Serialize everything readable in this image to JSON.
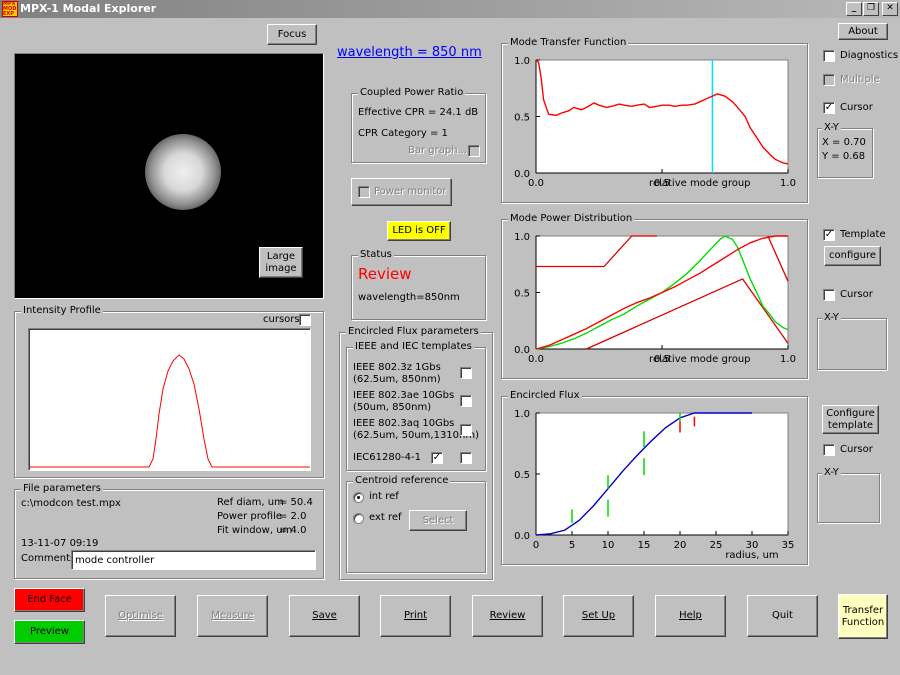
{
  "window": {
    "title": "MPX-1 Modal Explorer",
    "icon_text": "MPX MOD EXP",
    "min": "_",
    "restore": "❐",
    "close": "✕"
  },
  "top": {
    "focus_label": "Focus",
    "wavelength_text": "wavelength = 850 nm",
    "about_label": "About"
  },
  "image": {
    "large_label": "Large\nimage"
  },
  "intensity": {
    "title": "Intensity Profile",
    "cursors_label": "cursors"
  },
  "cpr": {
    "title": "Coupled Power Ratio",
    "effective": "Effective CPR = 24.1 dB",
    "category": "CPR Category = 1",
    "bar_graph": "Bar graph..."
  },
  "power_monitor": {
    "label": "Power monitor"
  },
  "led": {
    "label": "LED is OFF"
  },
  "status": {
    "title": "Status",
    "state": "Review",
    "wavelength": "wavelength=850nm"
  },
  "ef_params": {
    "title": "Encircled Flux parameters",
    "templates_title": "IEEE and IEC templates",
    "templates": [
      {
        "line1": "IEEE 802.3z 1Gbs",
        "line2": "(62.5um, 850nm)",
        "c1": false,
        "c2": null
      },
      {
        "line1": "IEEE 802.3ae 10Gbs",
        "line2": "(50um, 850nm)",
        "c1": false,
        "c2": null
      },
      {
        "line1": "IEEE 802.3aq 10Gbs",
        "line2": "(62.5um, 50um,1310nm)",
        "c1": false,
        "c2": null
      },
      {
        "line1": "IEC61280-4-1",
        "line2": "",
        "c1": true,
        "c2": false
      }
    ],
    "centroid_title": "Centroid reference",
    "int_ref": "int ref",
    "ext_ref": "ext ref",
    "select_label": "Select"
  },
  "file": {
    "title": "File parameters",
    "path": "c:\\modcon test.mpx",
    "ref_diam_label": "Ref diam, um",
    "ref_diam": "= 50.4",
    "power_profile_label": "Power profile",
    "power_profile": "= 2.0",
    "fit_window_label": "Fit window, um",
    "fit_window": "= 4.0",
    "date": "13-11-07 09:19",
    "comments_label": "Comments:",
    "comments_value": "mode controller"
  },
  "right": {
    "diagnostics": "Diagnostics",
    "multiple": "Multiple",
    "cursor": "Cursor",
    "xy_label": "X-Y",
    "x": "X = 0.70",
    "y": "Y = 0.68",
    "template": "Template",
    "configure": "configure",
    "cursor2": "Cursor",
    "xy2": "X-Y",
    "configure_template": "Configure\ntemplate",
    "cursor3": "Cursor",
    "xy3": "X-Y"
  },
  "checks": {
    "diagnostics": false,
    "multiple": false,
    "cursor": true,
    "template": true,
    "cursor2": false,
    "cursor3": false,
    "cursors_profile": false,
    "power_monitor": false,
    "bar_graph": false
  },
  "buttons": {
    "end_face": "End Face",
    "preview": "Preview",
    "optimise": "Optimise",
    "measure": "Measure",
    "save": "Save",
    "print": "Print",
    "review": "Review",
    "setup": "Set Up",
    "help": "Help",
    "quit": "Quit",
    "transfer": "Transfer\nFunction"
  },
  "colors": {
    "led": "#ffff00",
    "end_face": "#ff0000",
    "preview": "#00cc00",
    "transfer": "#ffffc0",
    "review_text": "#ff0000",
    "wavelength_link": "#0000ff"
  },
  "chart_data": [
    {
      "title": "Mode Transfer Function",
      "type": "line",
      "xlabel": "relative mode group",
      "xlim": [
        0,
        1
      ],
      "ylim": [
        0,
        1
      ],
      "xticks": [
        "0.0",
        "0.5",
        "1.0"
      ],
      "yticks": [
        "1.0",
        "0.5",
        "0.0"
      ],
      "series": [
        {
          "color": "#ff0000",
          "x": [
            0.0,
            0.01,
            0.02,
            0.03,
            0.05,
            0.08,
            0.1,
            0.13,
            0.15,
            0.18,
            0.2,
            0.23,
            0.25,
            0.28,
            0.3,
            0.33,
            0.35,
            0.38,
            0.4,
            0.43,
            0.45,
            0.48,
            0.5,
            0.53,
            0.55,
            0.58,
            0.6,
            0.63,
            0.65,
            0.68,
            0.7,
            0.72,
            0.75,
            0.78,
            0.8,
            0.83,
            0.85,
            0.88,
            0.9,
            0.93,
            0.95,
            0.98,
            1.0
          ],
          "y": [
            1.0,
            0.98,
            0.85,
            0.65,
            0.52,
            0.51,
            0.53,
            0.55,
            0.58,
            0.56,
            0.58,
            0.62,
            0.6,
            0.58,
            0.59,
            0.61,
            0.6,
            0.59,
            0.6,
            0.61,
            0.58,
            0.59,
            0.6,
            0.6,
            0.59,
            0.6,
            0.6,
            0.61,
            0.63,
            0.66,
            0.68,
            0.7,
            0.68,
            0.63,
            0.58,
            0.5,
            0.4,
            0.3,
            0.23,
            0.16,
            0.12,
            0.09,
            0.08
          ]
        }
      ],
      "cursor_x": 0.7
    },
    {
      "title": "Mode Power Distribution",
      "type": "line",
      "xlabel": "relative mode group",
      "xlim": [
        0,
        1
      ],
      "ylim": [
        0,
        1
      ],
      "xticks": [
        "0.0",
        "0.5",
        "1.0"
      ],
      "yticks": [
        "1.0",
        "0.5",
        "0.0"
      ],
      "series": [
        {
          "color": "#00dd00",
          "x": [
            0.0,
            0.05,
            0.1,
            0.15,
            0.2,
            0.25,
            0.3,
            0.35,
            0.4,
            0.45,
            0.5,
            0.55,
            0.6,
            0.65,
            0.7,
            0.73,
            0.75,
            0.78,
            0.8,
            0.82,
            0.85,
            0.88,
            0.9,
            0.93,
            0.95,
            0.98,
            1.0
          ],
          "y": [
            0.0,
            0.02,
            0.05,
            0.09,
            0.14,
            0.2,
            0.26,
            0.31,
            0.38,
            0.44,
            0.5,
            0.58,
            0.67,
            0.78,
            0.9,
            0.97,
            1.0,
            0.97,
            0.9,
            0.79,
            0.62,
            0.48,
            0.38,
            0.3,
            0.24,
            0.19,
            0.17
          ]
        },
        {
          "color": "#ff0000",
          "x": [
            0.0,
            0.05,
            0.1,
            0.15,
            0.2,
            0.25,
            0.3,
            0.35,
            0.4,
            0.45,
            0.5,
            0.55,
            0.6,
            0.65,
            0.7,
            0.75,
            0.8,
            0.85,
            0.9,
            0.95,
            1.0
          ],
          "y": [
            0.0,
            0.03,
            0.08,
            0.13,
            0.18,
            0.24,
            0.3,
            0.36,
            0.41,
            0.45,
            0.5,
            0.55,
            0.61,
            0.67,
            0.74,
            0.81,
            0.88,
            0.94,
            0.98,
            1.0,
            1.0
          ]
        }
      ],
      "template_lines": [
        {
          "x": [
            0.0,
            0.27,
            0.38,
            0.48
          ],
          "y": [
            0.73,
            0.73,
            1.0,
            1.0
          ]
        },
        {
          "x": [
            0.2,
            0.82,
            1.0
          ],
          "y": [
            0.0,
            0.62,
            0.05
          ]
        },
        {
          "x": [
            0.92,
            1.0
          ],
          "y": [
            1.0,
            0.6
          ]
        }
      ]
    },
    {
      "title": "Encircled Flux",
      "type": "line",
      "xlabel": "radius, um",
      "xlim": [
        0,
        35
      ],
      "ylim": [
        0,
        1
      ],
      "xticks": [
        "0",
        "5",
        "10",
        "15",
        "20",
        "25",
        "30",
        "35"
      ],
      "yticks": [
        "1.0",
        "0.5",
        "0.0"
      ],
      "series": [
        {
          "color": "#0000cc",
          "x": [
            0,
            2,
            4,
            6,
            8,
            10,
            12,
            14,
            16,
            18,
            20,
            22,
            24,
            26,
            28,
            30
          ],
          "y": [
            0.0,
            0.01,
            0.04,
            0.12,
            0.24,
            0.38,
            0.52,
            0.65,
            0.77,
            0.88,
            0.96,
            1.0,
            1.0,
            1.0,
            1.0,
            1.0
          ]
        }
      ],
      "markers": [
        {
          "x": 5,
          "y1": 0.1,
          "y2": 0.21,
          "color": "#00dd00"
        },
        {
          "x": 10,
          "y1": 0.15,
          "y2": 0.29,
          "color": "#00dd00"
        },
        {
          "x": 10,
          "y1": 0.38,
          "y2": 0.49,
          "color": "#00dd00"
        },
        {
          "x": 15,
          "y1": 0.49,
          "y2": 0.63,
          "color": "#00dd00"
        },
        {
          "x": 15,
          "y1": 0.72,
          "y2": 0.85,
          "color": "#00dd00"
        },
        {
          "x": 20,
          "y1": 0.84,
          "y2": 0.93,
          "color": "#ff0000"
        },
        {
          "x": 20,
          "y1": 0.93,
          "y2": 1.0,
          "color": "#00dd00"
        },
        {
          "x": 22,
          "y1": 0.89,
          "y2": 0.97,
          "color": "#ff0000"
        }
      ]
    }
  ]
}
